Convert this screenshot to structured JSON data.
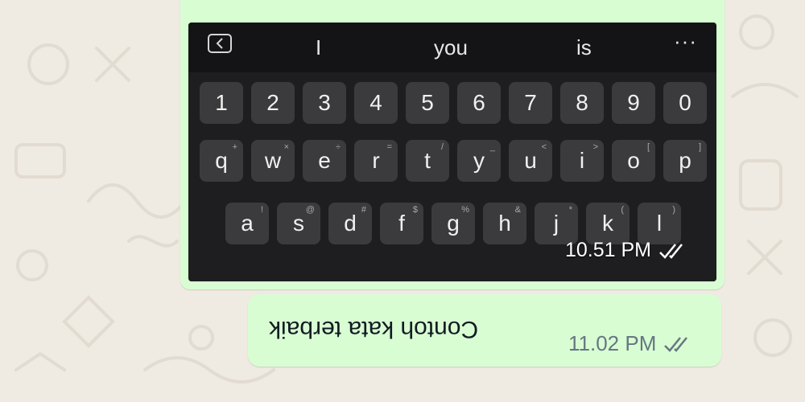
{
  "suggestions": {
    "words": [
      "I",
      "you",
      "is"
    ],
    "more": "···"
  },
  "keyboard": {
    "number_row": [
      "1",
      "2",
      "3",
      "4",
      "5",
      "6",
      "7",
      "8",
      "9",
      "0"
    ],
    "row_q": [
      {
        "key": "q",
        "hint": "+"
      },
      {
        "key": "w",
        "hint": "×"
      },
      {
        "key": "e",
        "hint": "÷"
      },
      {
        "key": "r",
        "hint": "="
      },
      {
        "key": "t",
        "hint": "/"
      },
      {
        "key": "y",
        "hint": "_"
      },
      {
        "key": "u",
        "hint": "<"
      },
      {
        "key": "i",
        "hint": ">"
      },
      {
        "key": "o",
        "hint": "["
      },
      {
        "key": "p",
        "hint": "]"
      }
    ],
    "row_a": [
      {
        "key": "a",
        "hint": "!"
      },
      {
        "key": "s",
        "hint": "@"
      },
      {
        "key": "d",
        "hint": "#"
      },
      {
        "key": "f",
        "hint": "$"
      },
      {
        "key": "g",
        "hint": "%"
      },
      {
        "key": "h",
        "hint": "&"
      },
      {
        "key": "j",
        "hint": "*"
      },
      {
        "key": "k",
        "hint": "("
      },
      {
        "key": "l",
        "hint": ")"
      }
    ]
  },
  "messages": {
    "image_timestamp": "10.51 PM",
    "text": "Contoh kata terbaik",
    "text_timestamp": "11.02 PM"
  },
  "colors": {
    "outgoing_bubble": "#d9fdd3",
    "wallpaper": "#efeae2",
    "keyboard_bg": "#1e1e20",
    "key_bg": "#3b3b3d"
  },
  "icons": {
    "read_receipt": "double-check-icon",
    "suggestion_back": "chevron-left-box-icon"
  }
}
